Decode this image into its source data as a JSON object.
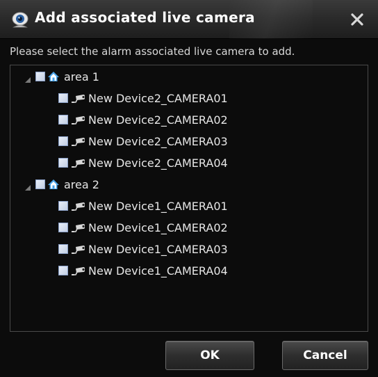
{
  "dialog": {
    "title": "Add associated live camera",
    "close_glyph": "✕",
    "instruction": "Please select the alarm associated live camera to add."
  },
  "tree": [
    {
      "label": "area 1",
      "icon": "home-icon",
      "expanded": true,
      "checked": false,
      "children": [
        {
          "label": "New Device2_CAMERA01",
          "icon": "camera-icon",
          "checked": false
        },
        {
          "label": "New Device2_CAMERA02",
          "icon": "camera-icon",
          "checked": false
        },
        {
          "label": "New Device2_CAMERA03",
          "icon": "camera-icon",
          "checked": false
        },
        {
          "label": "New Device2_CAMERA04",
          "icon": "camera-icon",
          "checked": false
        }
      ]
    },
    {
      "label": "area 2",
      "icon": "home-icon",
      "expanded": true,
      "checked": false,
      "children": [
        {
          "label": "New Device1_CAMERA01",
          "icon": "camera-icon",
          "checked": false
        },
        {
          "label": "New Device1_CAMERA02",
          "icon": "camera-icon",
          "checked": false
        },
        {
          "label": "New Device1_CAMERA03",
          "icon": "camera-icon",
          "checked": false
        },
        {
          "label": "New Device1_CAMERA04",
          "icon": "camera-icon",
          "checked": false
        }
      ]
    }
  ],
  "buttons": {
    "ok_label": "OK",
    "cancel_label": "Cancel"
  },
  "colors": {
    "background": "#0c0c0c",
    "text": "#e6e6e6",
    "home_icon": "#4aa3e8",
    "checkbox_border": "#8aa0c8"
  }
}
